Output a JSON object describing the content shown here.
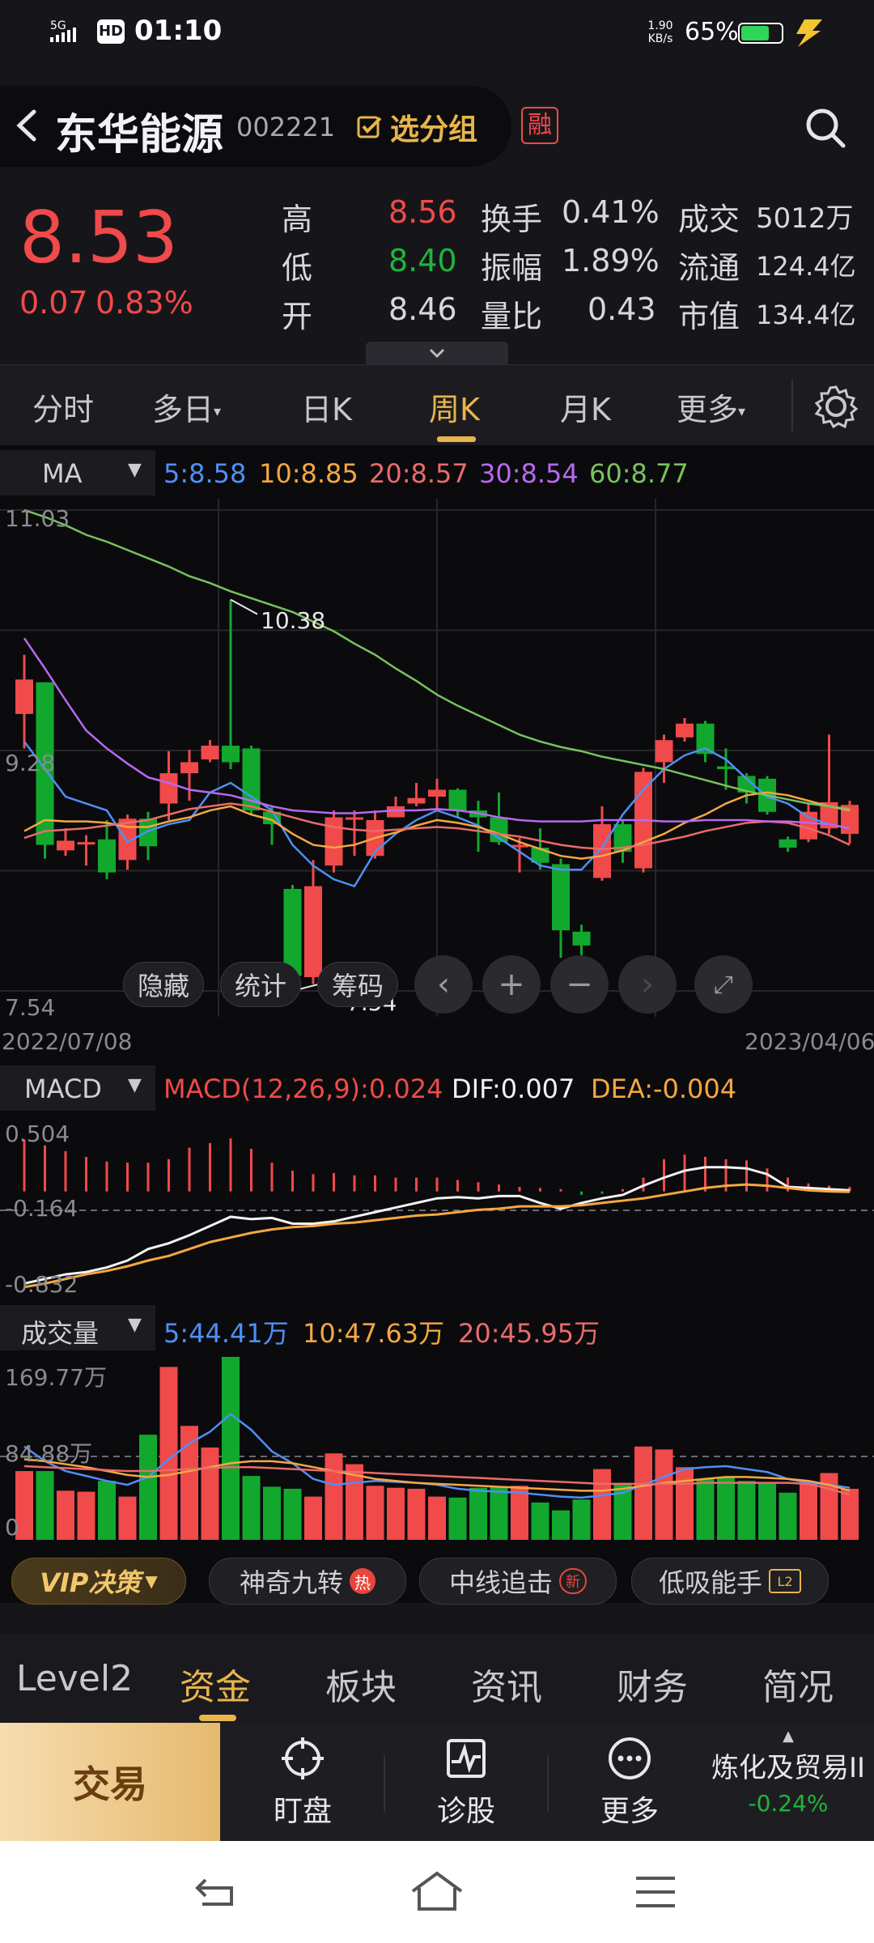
{
  "status": {
    "signal": "5G",
    "hd": "HD",
    "time": "01:10",
    "speed_top": "1.90",
    "speed_bottom": "KB/s",
    "battery": "65%"
  },
  "header": {
    "name": "东华能源",
    "code": "002221",
    "group_btn": "选分组",
    "rong": "融"
  },
  "quote": {
    "price": "8.53",
    "change": "0.07",
    "change_pct": "0.83%",
    "rows": [
      {
        "l1": "高",
        "v1": "8.56",
        "l2": "换手",
        "v2": "0.41%",
        "l3": "成交",
        "v3": "5012万"
      },
      {
        "l1": "低",
        "v1": "8.40",
        "l2": "振幅",
        "v2": "1.89%",
        "l3": "流通",
        "v3": "124.4亿"
      },
      {
        "l1": "开",
        "v1": "8.46",
        "l2": "量比",
        "v2": "0.43",
        "l3": "市值",
        "v3": "134.4亿"
      }
    ]
  },
  "tabs": [
    "分时",
    "多日",
    "日K",
    "周K",
    "月K",
    "更多"
  ],
  "ma_bar": {
    "label": "MA",
    "ma5": "5:8.58",
    "ma10": "10:8.85",
    "ma20": "20:8.57",
    "ma30": "30:8.54",
    "ma60": "60:8.77"
  },
  "kchart": {
    "y_top": "11.03",
    "y_mid": "9.28",
    "y_bottom": "7.54",
    "high_label": "10.38",
    "low_label": "7.54",
    "date_start": "2022/07/08",
    "date_end": "2023/04/06",
    "overlay": {
      "hide": "隐藏",
      "stats": "统计",
      "chips": "筹码"
    }
  },
  "macd": {
    "label": "MACD",
    "macd_val": "MACD(12,26,9):0.024",
    "dif": "DIF:0.007",
    "dea": "DEA:-0.004",
    "y_top": "0.504",
    "y_mid": "-0.164",
    "y_bottom": "-0.832"
  },
  "volume": {
    "label": "成交量",
    "v5": "5:44.41万",
    "v10": "10:47.63万",
    "v20": "20:45.95万",
    "y_top": "169.77万",
    "y_mid": "84.88万",
    "y_bottom": "0"
  },
  "features": {
    "vip": "VIP决策",
    "f1": "神奇九转",
    "f1_badge": "热",
    "f2": "中线追击",
    "f2_badge": "新",
    "f3": "低吸能手",
    "f3_badge": "L2"
  },
  "bottom_tabs": [
    "Level2",
    "资金",
    "板块",
    "资讯",
    "财务",
    "简况"
  ],
  "actions": {
    "trade": "交易",
    "watch": "盯盘",
    "diagnose": "诊股",
    "more": "更多",
    "sector": "炼化及贸易II",
    "sector_change": "-0.24%"
  },
  "colors": {
    "up": "#f04a4a",
    "down": "#12a82e",
    "accent": "#e8b54c",
    "ma5": "#4f8ff7",
    "ma10": "#f5a742",
    "ma20": "#ea6b6b",
    "ma30": "#b968f0",
    "ma60": "#78c25d"
  },
  "chart_data": {
    "type": "candlestick",
    "period": "weekly",
    "x_range": [
      "2022/07/08",
      "2023/04/06"
    ],
    "ylim": [
      7.54,
      11.03
    ],
    "candles": [
      {
        "o": 9.55,
        "c": 9.8,
        "h": 9.98,
        "l": 9.3
      },
      {
        "o": 9.78,
        "c": 8.6,
        "h": 9.78,
        "l": 8.5
      },
      {
        "o": 8.56,
        "c": 8.63,
        "h": 8.72,
        "l": 8.52
      },
      {
        "o": 8.62,
        "c": 8.62,
        "h": 8.67,
        "l": 8.45
      },
      {
        "o": 8.64,
        "c": 8.4,
        "h": 8.78,
        "l": 8.35
      },
      {
        "o": 8.49,
        "c": 8.79,
        "h": 8.82,
        "l": 8.42
      },
      {
        "o": 8.79,
        "c": 8.59,
        "h": 8.84,
        "l": 8.49
      },
      {
        "o": 8.9,
        "c": 9.12,
        "h": 9.28,
        "l": 8.78
      },
      {
        "o": 9.12,
        "c": 9.2,
        "h": 9.29,
        "l": 8.92
      },
      {
        "o": 9.22,
        "c": 9.32,
        "h": 9.36,
        "l": 9.2
      },
      {
        "o": 9.32,
        "c": 9.2,
        "h": 10.38,
        "l": 9.15
      },
      {
        "o": 9.3,
        "c": 8.85,
        "h": 9.32,
        "l": 8.82
      },
      {
        "o": 8.84,
        "c": 8.75,
        "h": 8.88,
        "l": 8.6
      },
      {
        "o": 8.28,
        "c": 7.65,
        "h": 8.31,
        "l": 7.54
      },
      {
        "o": 7.64,
        "c": 8.3,
        "h": 8.49,
        "l": 7.59
      },
      {
        "o": 8.45,
        "c": 8.8,
        "h": 8.85,
        "l": 8.4
      },
      {
        "o": 8.8,
        "c": 8.8,
        "h": 8.85,
        "l": 8.52
      },
      {
        "o": 8.52,
        "c": 8.78,
        "h": 8.85,
        "l": 8.5
      },
      {
        "o": 8.8,
        "c": 8.88,
        "h": 8.95,
        "l": 8.8
      },
      {
        "o": 8.9,
        "c": 8.94,
        "h": 9.05,
        "l": 8.88
      },
      {
        "o": 8.95,
        "c": 9.0,
        "h": 9.08,
        "l": 8.85
      },
      {
        "o": 9.0,
        "c": 8.85,
        "h": 9.01,
        "l": 8.8
      },
      {
        "o": 8.85,
        "c": 8.8,
        "h": 8.92,
        "l": 8.55
      },
      {
        "o": 8.8,
        "c": 8.62,
        "h": 8.98,
        "l": 8.6
      },
      {
        "o": 8.6,
        "c": 8.6,
        "h": 8.65,
        "l": 8.4
      },
      {
        "o": 8.58,
        "c": 8.47,
        "h": 8.72,
        "l": 8.42
      },
      {
        "o": 8.46,
        "c": 7.98,
        "h": 8.5,
        "l": 7.78
      },
      {
        "o": 7.97,
        "c": 7.87,
        "h": 8.02,
        "l": 7.8
      },
      {
        "o": 8.36,
        "c": 8.75,
        "h": 8.88,
        "l": 8.34
      },
      {
        "o": 8.75,
        "c": 8.55,
        "h": 8.78,
        "l": 8.47
      },
      {
        "o": 8.43,
        "c": 9.13,
        "h": 9.16,
        "l": 8.4
      },
      {
        "o": 9.2,
        "c": 9.36,
        "h": 9.4,
        "l": 9.05
      },
      {
        "o": 9.38,
        "c": 9.48,
        "h": 9.52,
        "l": 9.35
      },
      {
        "o": 9.48,
        "c": 9.26,
        "h": 9.5,
        "l": 9.2
      },
      {
        "o": 9.17,
        "c": 9.15,
        "h": 9.3,
        "l": 9.0
      },
      {
        "o": 9.1,
        "c": 8.98,
        "h": 9.12,
        "l": 8.9
      },
      {
        "o": 9.08,
        "c": 8.84,
        "h": 9.1,
        "l": 8.82
      },
      {
        "o": 8.64,
        "c": 8.58,
        "h": 8.66,
        "l": 8.55
      },
      {
        "o": 8.64,
        "c": 8.84,
        "h": 8.9,
        "l": 8.62
      },
      {
        "o": 8.72,
        "c": 8.91,
        "h": 9.4,
        "l": 8.68
      },
      {
        "o": 8.68,
        "c": 8.89,
        "h": 8.92,
        "l": 8.61
      }
    ],
    "ma": {
      "ma5": [
        9.35,
        9.15,
        8.95,
        8.9,
        8.85,
        8.62,
        8.7,
        8.75,
        8.78,
        8.98,
        9.05,
        8.95,
        8.85,
        8.6,
        8.45,
        8.35,
        8.3,
        8.55,
        8.68,
        8.78,
        8.85,
        8.8,
        8.74,
        8.65,
        8.55,
        8.45,
        8.42,
        8.42,
        8.58,
        8.82,
        9.0,
        9.15,
        9.25,
        9.3,
        9.22,
        9.08,
        8.95,
        8.9,
        8.8,
        8.75,
        8.72
      ],
      "ma10": [
        8.7,
        8.78,
        8.77,
        8.77,
        8.76,
        8.73,
        8.73,
        8.77,
        8.8,
        8.85,
        8.88,
        8.82,
        8.78,
        8.68,
        8.6,
        8.58,
        8.6,
        8.65,
        8.69,
        8.74,
        8.78,
        8.76,
        8.73,
        8.68,
        8.62,
        8.57,
        8.52,
        8.5,
        8.52,
        8.56,
        8.62,
        8.68,
        8.76,
        8.82,
        8.9,
        8.96,
        8.98,
        8.96,
        8.92,
        8.88,
        8.85
      ],
      "ma20": [
        8.65,
        8.7,
        8.71,
        8.72,
        8.74,
        8.76,
        8.78,
        8.82,
        8.86,
        8.88,
        8.9,
        8.88,
        8.84,
        8.8,
        8.76,
        8.73,
        8.71,
        8.7,
        8.71,
        8.72,
        8.73,
        8.72,
        8.7,
        8.68,
        8.66,
        8.63,
        8.6,
        8.58,
        8.57,
        8.58,
        8.6,
        8.63,
        8.66,
        8.7,
        8.73,
        8.76,
        8.77,
        8.76,
        8.72,
        8.67,
        8.6
      ],
      "ma30": [
        10.1,
        9.88,
        9.65,
        9.43,
        9.3,
        9.19,
        9.09,
        9.05,
        9.0,
        8.98,
        8.96,
        8.92,
        8.88,
        8.85,
        8.84,
        8.83,
        8.83,
        8.84,
        8.85,
        8.85,
        8.86,
        8.85,
        8.83,
        8.8,
        8.78,
        8.77,
        8.77,
        8.77,
        8.78,
        8.78,
        8.78,
        8.77,
        8.77,
        8.78,
        8.78,
        8.78,
        8.77,
        8.77,
        8.76,
        8.75,
        8.72
      ],
      "ma60": [
        11.03,
        10.98,
        10.92,
        10.85,
        10.8,
        10.74,
        10.68,
        10.62,
        10.55,
        10.5,
        10.44,
        10.39,
        10.34,
        10.29,
        10.22,
        10.15,
        10.06,
        9.98,
        9.88,
        9.79,
        9.69,
        9.61,
        9.54,
        9.47,
        9.4,
        9.35,
        9.31,
        9.28,
        9.24,
        9.21,
        9.18,
        9.15,
        9.11,
        9.07,
        9.03,
        8.99,
        8.96,
        8.93,
        8.9,
        8.88,
        8.86
      ]
    },
    "macd_hist": [
      0.45,
      0.4,
      0.35,
      0.3,
      0.26,
      0.25,
      0.25,
      0.28,
      0.38,
      0.42,
      0.46,
      0.37,
      0.25,
      0.18,
      0.15,
      0.16,
      0.14,
      0.14,
      0.12,
      0.12,
      0.12,
      0.1,
      0.08,
      0.06,
      0.04,
      0.03,
      0.02,
      -0.03,
      -0.02,
      0.02,
      0.12,
      0.28,
      0.32,
      0.3,
      0.28,
      0.27,
      0.2,
      0.12,
      0.07,
      0.05,
      0.04
    ],
    "dif": [
      -0.8,
      -0.76,
      -0.72,
      -0.7,
      -0.66,
      -0.6,
      -0.5,
      -0.45,
      -0.38,
      -0.3,
      -0.22,
      -0.24,
      -0.23,
      -0.28,
      -0.28,
      -0.26,
      -0.22,
      -0.18,
      -0.14,
      -0.1,
      -0.06,
      -0.05,
      -0.06,
      -0.04,
      -0.04,
      -0.1,
      -0.15,
      -0.1,
      -0.06,
      -0.03,
      0.05,
      0.12,
      0.18,
      0.21,
      0.21,
      0.2,
      0.15,
      0.04,
      0.03,
      0.02,
      0.01
    ],
    "dea": [
      -0.83,
      -0.8,
      -0.76,
      -0.72,
      -0.69,
      -0.65,
      -0.6,
      -0.56,
      -0.5,
      -0.44,
      -0.4,
      -0.36,
      -0.33,
      -0.31,
      -0.3,
      -0.28,
      -0.27,
      -0.25,
      -0.23,
      -0.21,
      -0.2,
      -0.18,
      -0.16,
      -0.15,
      -0.13,
      -0.13,
      -0.13,
      -0.12,
      -0.1,
      -0.08,
      -0.06,
      -0.03,
      0.0,
      0.03,
      0.05,
      0.06,
      0.05,
      0.03,
      0.01,
      0.0,
      -0.004
    ],
    "volume": [
      70,
      70,
      50,
      49,
      60,
      44,
      107,
      176,
      116,
      94,
      192,
      65,
      54,
      52,
      44,
      88,
      77,
      55,
      53,
      52,
      44,
      43,
      53,
      54,
      55,
      38,
      30,
      41,
      72,
      58,
      95,
      92,
      74,
      62,
      64,
      60,
      58,
      48,
      57,
      68,
      52
    ],
    "volume_ma": {
      "ma5": [
        95,
        80,
        70,
        65,
        60,
        56,
        64,
        82,
        98,
        110,
        128,
        112,
        90,
        78,
        62,
        56,
        58,
        60,
        59,
        58,
        56,
        52,
        50,
        49,
        48,
        46,
        44,
        43,
        45,
        48,
        56,
        64,
        72,
        74,
        75,
        72,
        69,
        62,
        58,
        56,
        53
      ],
      "ma10": [
        82,
        80,
        77,
        74,
        70,
        66,
        64,
        66,
        70,
        74,
        78,
        80,
        80,
        78,
        74,
        70,
        66,
        62,
        60,
        58,
        57,
        56,
        55,
        54,
        53,
        52,
        51,
        50,
        50,
        52,
        55,
        58,
        60,
        62,
        64,
        64,
        63,
        62,
        60,
        56,
        50
      ],
      "ma20": [
        75,
        74,
        73,
        72,
        71,
        70,
        70,
        71,
        72,
        73,
        74,
        74,
        73,
        72,
        71,
        70,
        69,
        68,
        67,
        66,
        65,
        64,
        63,
        62,
        61,
        60,
        59,
        58,
        57,
        57,
        57,
        57,
        57,
        58,
        58,
        58,
        58,
        58,
        57,
        52,
        46
      ]
    }
  }
}
